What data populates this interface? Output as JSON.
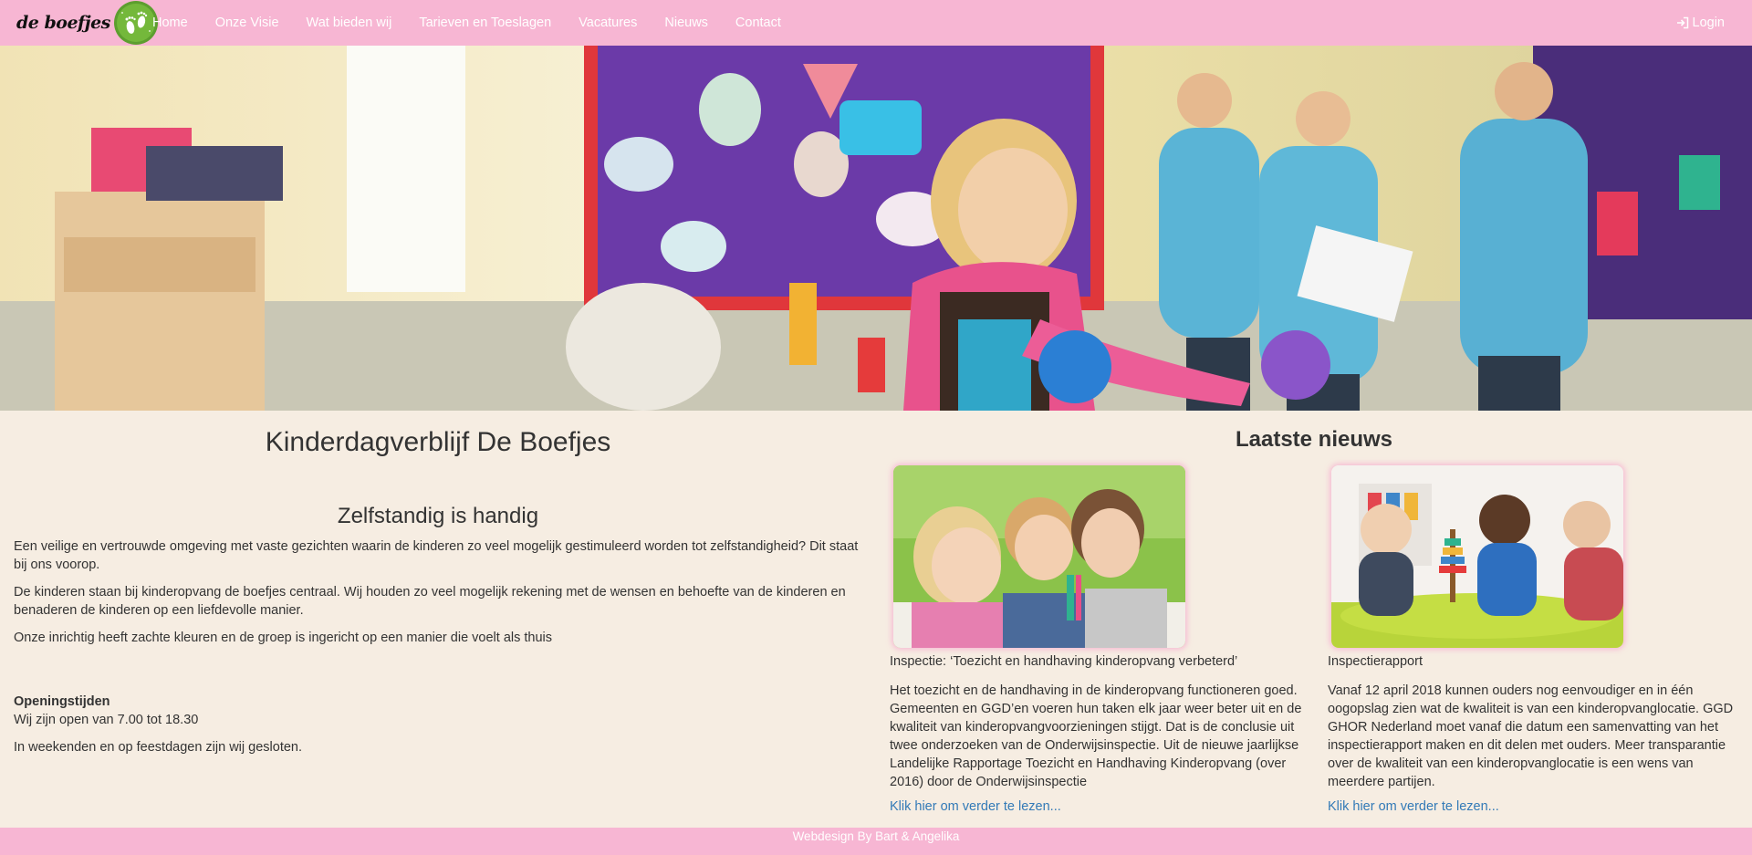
{
  "brand": {
    "name": "de boefjes"
  },
  "nav": {
    "items": [
      {
        "label": "Home"
      },
      {
        "label": "Onze Visie"
      },
      {
        "label": "Wat bieden wij"
      },
      {
        "label": "Tarieven en Toeslagen"
      },
      {
        "label": "Vacatures"
      },
      {
        "label": "Nieuws"
      },
      {
        "label": "Contact"
      }
    ],
    "login_label": "Login",
    "login_icon": "login-icon"
  },
  "main": {
    "title": "Kinderdagverblijf De Boefjes",
    "subtitle": "Zelfstandig is handig",
    "paragraphs": [
      "Een veilige en vertrouwde omgeving met vaste gezichten waarin de kinderen zo veel mogelijk gestimuleerd worden tot zelfstandigheid? Dit staat bij ons voorop.",
      "De kinderen staan bij kinderopvang de boefjes centraal. Wij houden zo veel mogelijk rekening met de wensen en behoefte van de kinderen en benaderen de kinderen op een liefdevolle manier.",
      "Onze inrichtig heeft zachte kleuren en de groep is ingericht op een manier die voelt als thuis"
    ],
    "hours_title": "Openingstijden",
    "hours_text": "Wij zijn open van 7.00 tot 18.30",
    "closed_text": "In weekenden en op feestdagen zijn wij gesloten."
  },
  "news": {
    "title": "Laatste nieuws",
    "items": [
      {
        "headline": "Inspectie: ‘Toezicht en handhaving kinderopvang verbeterd’",
        "body": "Het toezicht en de handhaving in de kinderopvang functioneren goed. Gemeenten en GGD’en voeren hun taken elk jaar weer beter uit en de kwaliteit van kinderopvangvoorzieningen stijgt. Dat is de conclusie uit twee onderzoeken van de Onderwijsinspectie. Uit de nieuwe jaarlijkse Landelijke Rapportage Toezicht en Handhaving Kinderopvang (over 2016) door de Onderwijsinspectie",
        "link": "Klik hier om verder te lezen..."
      },
      {
        "headline": "Inspectierapport",
        "body": "Vanaf 12 april 2018 kunnen ouders nog eenvoudiger en in één oogopslag zien wat de kwaliteit is van een kinderopvanglocatie. GGD GHOR Nederland moet vanaf die datum een samenvatting van het inspectierapport maken en dit delen met ouders. Meer transparantie over de kwaliteit van een kinderopvanglocatie is een wens van meerdere partijen.",
        "link": "Klik hier om verder te lezen..."
      }
    ]
  },
  "footer": {
    "text": "Webdesign By Bart & Angelika"
  },
  "colors": {
    "nav_bg": "#f7b6d3",
    "page_bg": "#f6ede2",
    "link": "#337ab7"
  }
}
